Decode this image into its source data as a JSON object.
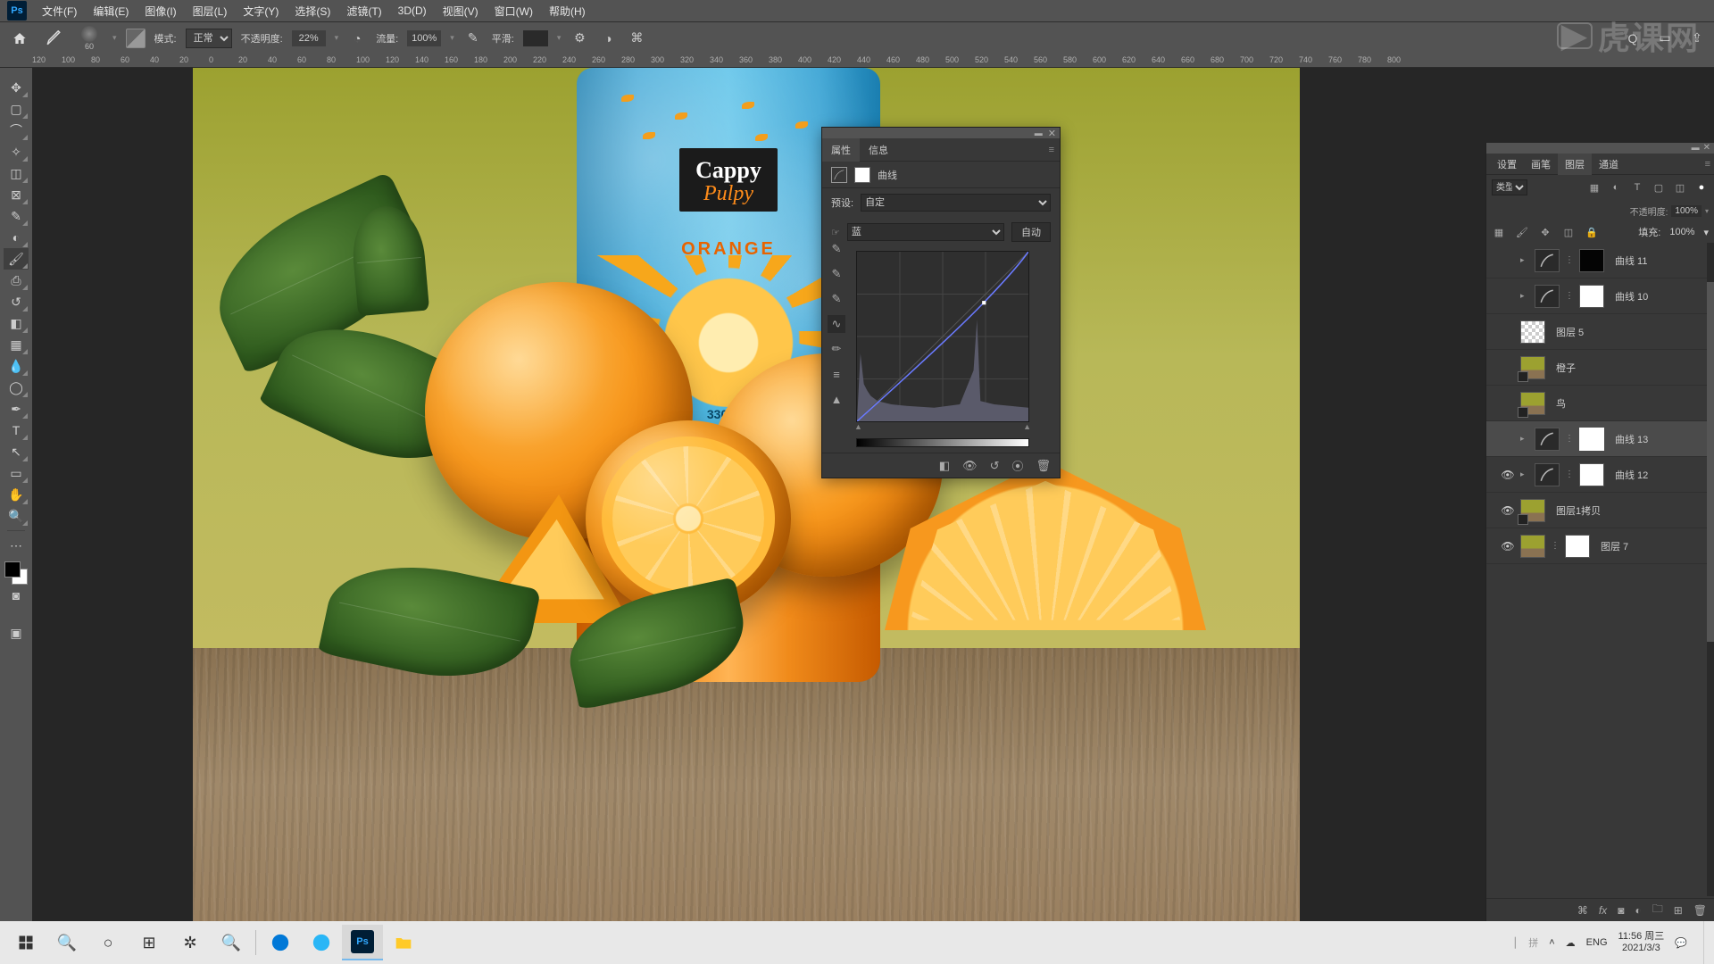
{
  "menu": {
    "items": [
      "文件(F)",
      "编辑(E)",
      "图像(I)",
      "图层(L)",
      "文字(Y)",
      "选择(S)",
      "滤镜(T)",
      "3D(D)",
      "视图(V)",
      "窗口(W)",
      "帮助(H)"
    ]
  },
  "options": {
    "brush_size": "60",
    "mode_label": "模式:",
    "mode_value": "正常",
    "opacity_label": "不透明度:",
    "opacity_value": "22%",
    "flow_label": "流量:",
    "flow_value": "100%",
    "smooth_label": "平滑:"
  },
  "ruler_ticks": [
    "120",
    "100",
    "80",
    "60",
    "40",
    "20",
    "0",
    "20",
    "40",
    "60",
    "80",
    "100",
    "120",
    "140",
    "160",
    "180",
    "200",
    "220",
    "240",
    "260",
    "280",
    "300",
    "320",
    "340",
    "360",
    "380",
    "400",
    "420",
    "440",
    "460",
    "480",
    "500",
    "520",
    "540",
    "560",
    "580",
    "600",
    "620",
    "640",
    "660",
    "680",
    "700",
    "720",
    "740",
    "760",
    "780",
    "800"
  ],
  "bottle": {
    "brand": "Cappy",
    "sub": "Pulpy",
    "flavor": "ORANGE",
    "volume": "330 mL"
  },
  "properties": {
    "tab_props": "属性",
    "tab_info": "信息",
    "adj_name": "曲线",
    "preset_label": "预设:",
    "preset_value": "自定",
    "channel_value": "蓝",
    "auto_btn": "自动"
  },
  "layers_panel": {
    "tab_set": "设置",
    "tab_brush": "画笔",
    "tab_layers": "图层",
    "tab_channels": "通道",
    "kind": "类型",
    "opacity_label": "不透明度:",
    "opacity_value": "100%",
    "fill_label": "填充:",
    "fill_value": "100%",
    "layers": [
      {
        "name": "曲线 11",
        "type": "adj",
        "mask": "black",
        "eye": false,
        "indent": 1
      },
      {
        "name": "曲线 10",
        "type": "adj",
        "mask": "white",
        "eye": false,
        "indent": 1
      },
      {
        "name": "图层 5",
        "type": "img",
        "eye": false,
        "indent": 1
      },
      {
        "name": "橙子",
        "type": "smart",
        "eye": false,
        "indent": 1
      },
      {
        "name": "鸟",
        "type": "smart",
        "eye": false,
        "indent": 1
      },
      {
        "name": "曲线 13",
        "type": "adj",
        "mask": "white",
        "eye": false,
        "indent": 1,
        "selected": true,
        "active_mask": true
      },
      {
        "name": "曲线 12",
        "type": "adj",
        "mask": "white",
        "eye": true,
        "indent": 1
      },
      {
        "name": "图层1拷贝",
        "type": "smart",
        "eye": true,
        "indent": 1
      },
      {
        "name": "图层 7",
        "type": "img_mask",
        "mask": "white",
        "eye": true,
        "indent": 1
      }
    ]
  },
  "taskbar": {
    "lang1": "拼",
    "lang2": "ENG",
    "time": "11:56",
    "day": "周三",
    "date": "2021/3/3"
  },
  "watermark": "虎课网"
}
